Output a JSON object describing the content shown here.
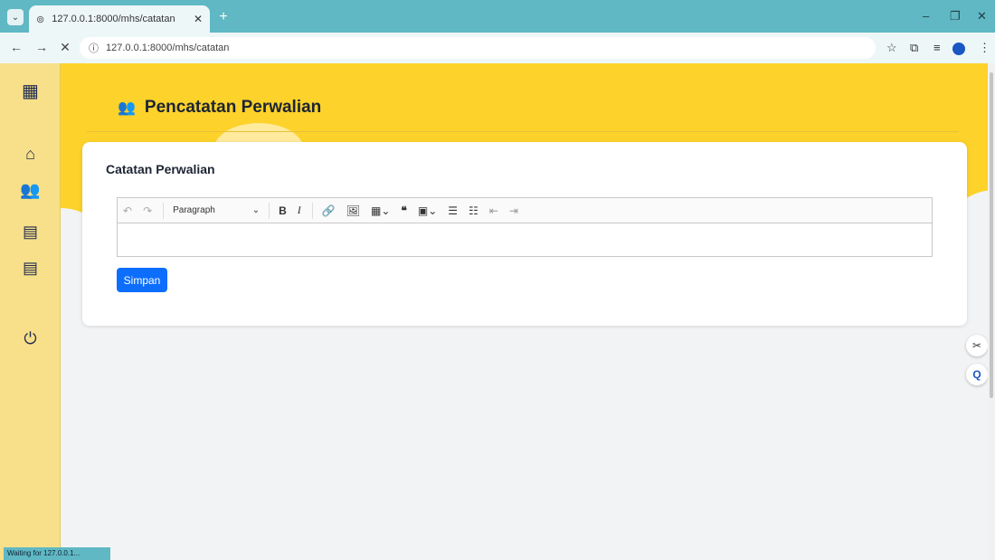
{
  "browser": {
    "tab_title": "127.0.0.1:8000/mhs/catatan",
    "url": "127.0.0.1:8000/mhs/catatan",
    "status_text": "Waiting for 127.0.0.1..."
  },
  "page": {
    "title": "Pencatatan Perwalian",
    "card_title": "Catatan Perwalian",
    "editor_heading_select": "Paragraph",
    "save_label": "Simpan"
  },
  "colors": {
    "accent_yellow": "#fdd22a",
    "sidebar": "#f8e08a",
    "primary_button": "#0d6efd",
    "browser_chrome": "#5fb8c4"
  }
}
